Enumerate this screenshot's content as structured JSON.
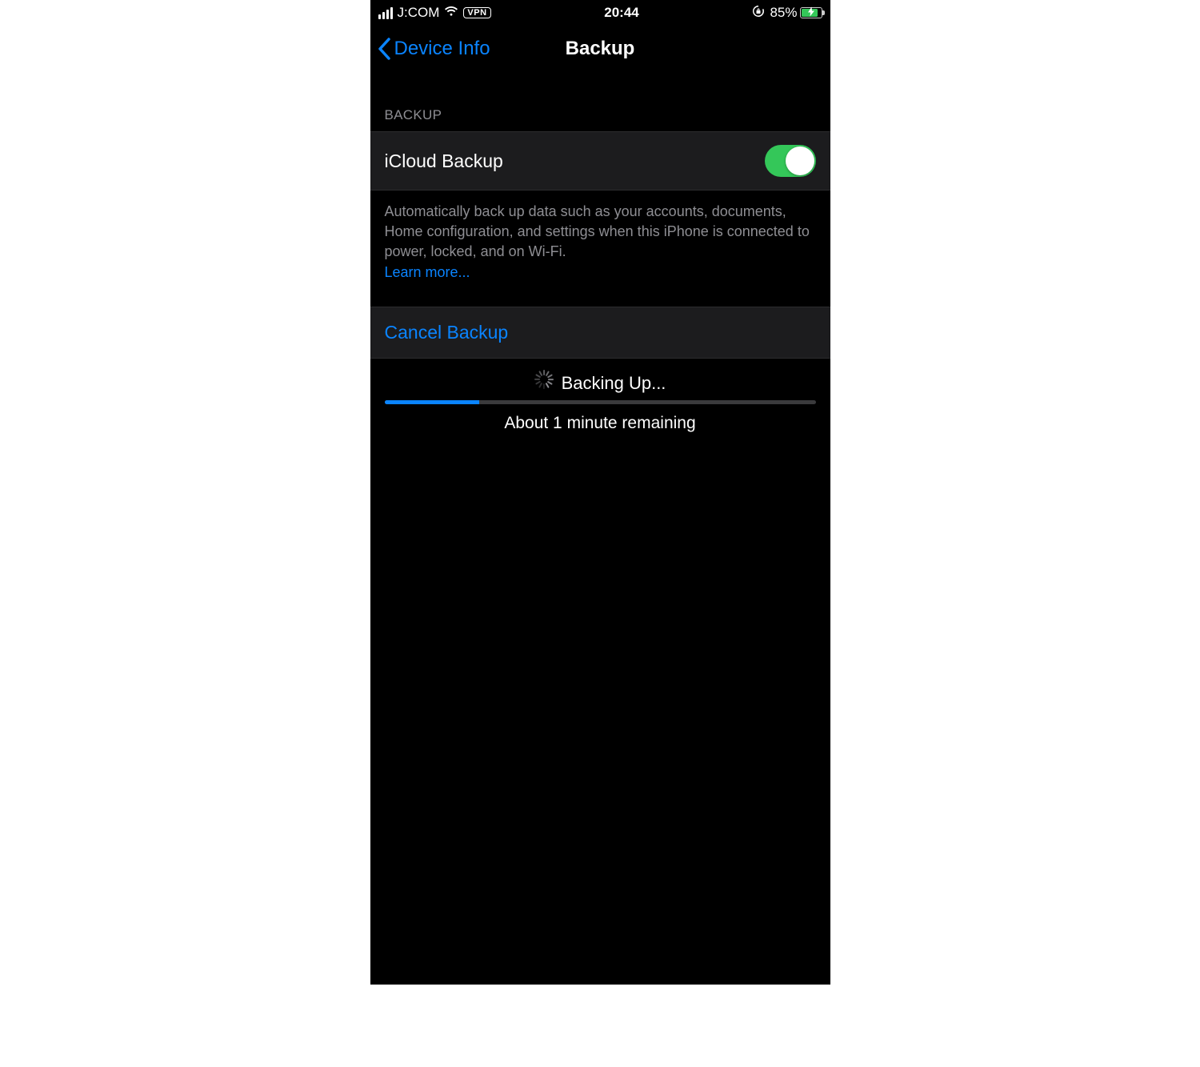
{
  "status_bar": {
    "carrier": "J:COM",
    "vpn_label": "VPN",
    "time": "20:44",
    "battery_percent_label": "85%",
    "battery_fill_percent": 85
  },
  "nav": {
    "back_label": "Device Info",
    "title": "Backup"
  },
  "backup_section": {
    "header": "BACKUP",
    "toggle_label": "iCloud Backup",
    "toggle_on": true,
    "description": "Automatically back up data such as your accounts, documents, Home configuration, and settings when this iPhone is connected to power, locked, and on Wi-Fi.",
    "learn_more": "Learn more..."
  },
  "cancel": {
    "label": "Cancel Backup"
  },
  "progress": {
    "status_label": "Backing Up...",
    "percent": 22,
    "time_remaining": "About 1 minute remaining"
  },
  "colors": {
    "accent": "#0a84ff",
    "toggle_on": "#34c759",
    "cell_bg": "#1c1c1e",
    "secondary_text": "#8e8e93"
  }
}
